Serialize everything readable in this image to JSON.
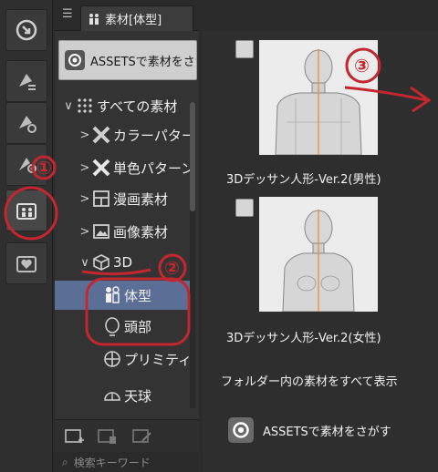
{
  "tab": {
    "label": "素材[体型]"
  },
  "assets_button": {
    "label": "ASSETSで素材をさがす"
  },
  "tree": {
    "items": [
      {
        "label": "すべての素材",
        "chevron": "∨",
        "icon": "grid-icon",
        "selected": false
      },
      {
        "label": "カラーパターン",
        "chevron": ">",
        "icon": "color-pattern-icon",
        "selected": false
      },
      {
        "label": "単色パターン",
        "chevron": ">",
        "icon": "mono-pattern-icon",
        "selected": false
      },
      {
        "label": "漫画素材",
        "chevron": ">",
        "icon": "manga-icon",
        "selected": false
      },
      {
        "label": "画像素材",
        "chevron": ">",
        "icon": "image-icon",
        "selected": false
      },
      {
        "label": "3D",
        "chevron": "∨",
        "icon": "cube-icon",
        "selected": false
      },
      {
        "label": "体型",
        "chevron": "",
        "icon": "figure-icon",
        "selected": true
      },
      {
        "label": "頭部",
        "chevron": "",
        "icon": "head-icon",
        "selected": false
      },
      {
        "label": "プリミティブ",
        "chevron": "",
        "icon": "primitive-icon",
        "selected": false
      },
      {
        "label": "天球",
        "chevron": "",
        "icon": "sky-dome-icon",
        "selected": false
      }
    ]
  },
  "search": {
    "label": "検索キーワード"
  },
  "content": {
    "items": [
      {
        "caption": "3Dデッサン人形-Ver.2(男性)"
      },
      {
        "caption": "3Dデッサン人形-Ver.2(女性)"
      }
    ],
    "show_all": "フォルダー内の素材をすべて表示",
    "assets_link": "ASSETSで素材をさがす"
  },
  "annotations": {
    "num1": "①",
    "num2": "②",
    "num3": "③"
  },
  "colors": {
    "annotation_red": "#c4262f",
    "selection_blue": "#5b6f96"
  }
}
